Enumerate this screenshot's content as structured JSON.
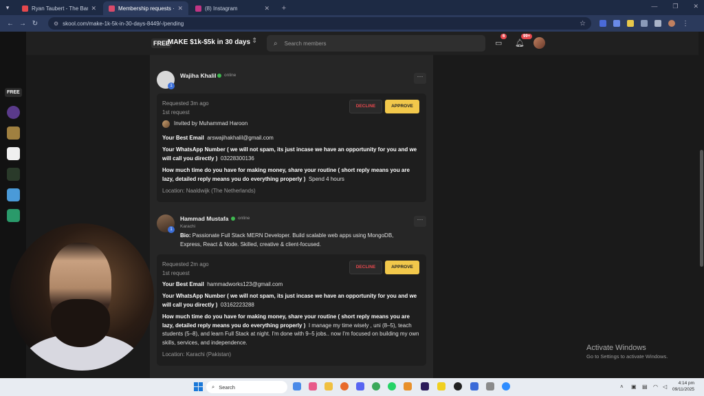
{
  "browser": {
    "tabs": [
      {
        "title": "Ryan Taubert - The Banquet - Y",
        "color": "#e5484d",
        "active": false
      },
      {
        "title": "Membership requests · MAKE $",
        "color": "#d84a6a",
        "active": true
      },
      {
        "title": "(8) Instagram",
        "color": "#c13584",
        "active": false
      }
    ],
    "url": "skool.com/make-1k-5k-in-30-days-8449/-/pending"
  },
  "header": {
    "free_badge": "FREE",
    "group_name": "MAKE $1k-$5k in 30 days",
    "search_placeholder": "Search members",
    "chat_badge": "6",
    "notif_badge": "99+"
  },
  "rail": {
    "free_label": "FREE"
  },
  "members": [
    {
      "name": "Wajiha Khalil",
      "status": "online",
      "level": "1",
      "requested": "Requested 3m ago",
      "request_count": "1st request",
      "invited_by": "Invited by Muhammad Haroon",
      "q_email": "Your Best Email",
      "a_email": "arswajihakhalil@gmail.com",
      "q_whatsapp": "Your WhatsApp Number ( we will not spam, its just incase we have an opportunity for you and we will call you directly )",
      "a_whatsapp": "03228300136",
      "q_time": "How much time do you have for making money, share your routine ( short reply means you are lazy, detailed reply means you do everything properly )",
      "a_time": "Spend 4 hours",
      "location": "Location: Naaldwijk (The Netherlands)"
    },
    {
      "name": "Hammad Mustafa",
      "status": "online",
      "level": "1",
      "city": "Karachi",
      "bio_label": "Bio:",
      "bio": "Passionate Full Stack MERN Developer. Build scalable web apps using MongoDB, Express, React & Node. Skilled, creative & client-focused.",
      "requested": "Requested 2m ago",
      "request_count": "1st request",
      "q_email": "Your Best Email",
      "a_email": "hammadworks123@gmail.com",
      "q_whatsapp": "Your WhatsApp Number ( we will not spam, its just incase we have an opportunity for you and we will call you directly )",
      "a_whatsapp": "03162223288",
      "q_time": "How much time do you have for making money, share your routine ( short reply means you are lazy, detailed reply means you do everything properly )",
      "a_time": "I manage my time wisely , uni (8–5), teach students (5–8), and learn Full Stack at night. I'm done with 9–5 jobs.. now I'm focused on building my own skills, services, and independence.",
      "location": "Location: Karachi (Pakistan)"
    }
  ],
  "buttons": {
    "decline": "DECLINE",
    "approve": "APPROVE",
    "more": "···"
  },
  "windows": {
    "activate_title": "Activate Windows",
    "activate_sub": "Go to Settings to activate Windows."
  },
  "taskbar": {
    "search": "Search",
    "time": "4:14 pm",
    "date": "09/11/2025"
  },
  "colors": {
    "accent": "#f2c84b",
    "decline": "#e5484d",
    "online": "#3fb950",
    "level": "#3c6fd8"
  }
}
